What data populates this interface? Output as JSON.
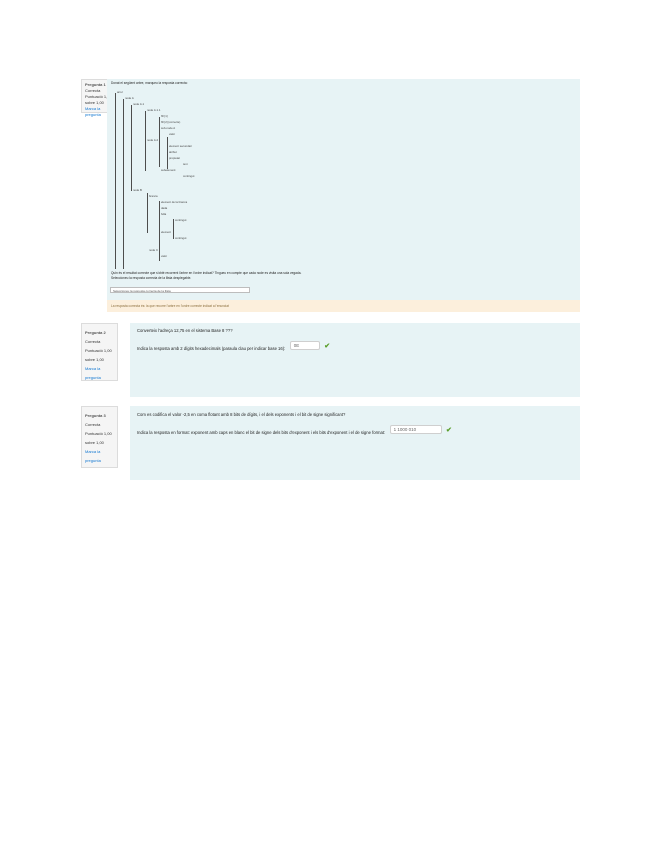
{
  "q1": {
    "info": [
      "Pregunta 1",
      "Correcta",
      "Puntuació 1,00 sobre 1,00",
      "Marca la pregunta"
    ],
    "intro": "Donat el següent arbre, marqueu la resposta correcta:",
    "tree_nodes": [
      "arrel",
      "node A",
      "node A.1",
      "node A.1.1",
      "fill [1]",
      "fill [2] (correcte)",
      "sub-node A",
      "valor",
      "node A.2",
      "element secundari",
      "atribut",
      "propietat",
      "text",
      "subelement",
      "contingut",
      "node B",
      "branca",
      "element de la branca",
      "dada",
      "fulla",
      "contingut",
      "element",
      "contingut",
      "node C",
      "valor"
    ],
    "question": "Quin és el resultat correcte que s'obté recorrent l'arbre en l'ordre indicat? Tingueu en compte que cada node es visita una sola vegada.",
    "question2": "Seleccioneu la resposta correcta de la llista desplegable.",
    "selected": "Seleccioneu la resposta correcta de la llista",
    "feedback": "La resposta correcta és: la que recorre l'arbre en l'ordre correcte indicat a l'enunciat"
  },
  "q2": {
    "info": [
      "Pregunta 2",
      "Correcta",
      "Puntuació 1,00 sobre 1,00",
      "Marca la pregunta"
    ],
    "line1": "Converteix l'adreça 12,75 en el sistema Base 8 ???",
    "line2": "Indica la resposta amb 2 dígits hexadecimals (paraula clau per indicar base 16):",
    "answer": "0E"
  },
  "q3": {
    "info": [
      "Pregunta 3",
      "Correcta",
      "Puntuació 1,00 sobre 1,00",
      "Marca la pregunta"
    ],
    "line1": "Com es codifica el valor -2,5 en coma flotant amb 8 bits de dígits, i el dels exponents i el bit de signe significant?",
    "line2": "Indica la resposta en format: exponent amb caps en blanc el bit de signe dels bits d'exponent i els bits d'exponent i el de signe format:",
    "answer": "1 1000 010"
  }
}
